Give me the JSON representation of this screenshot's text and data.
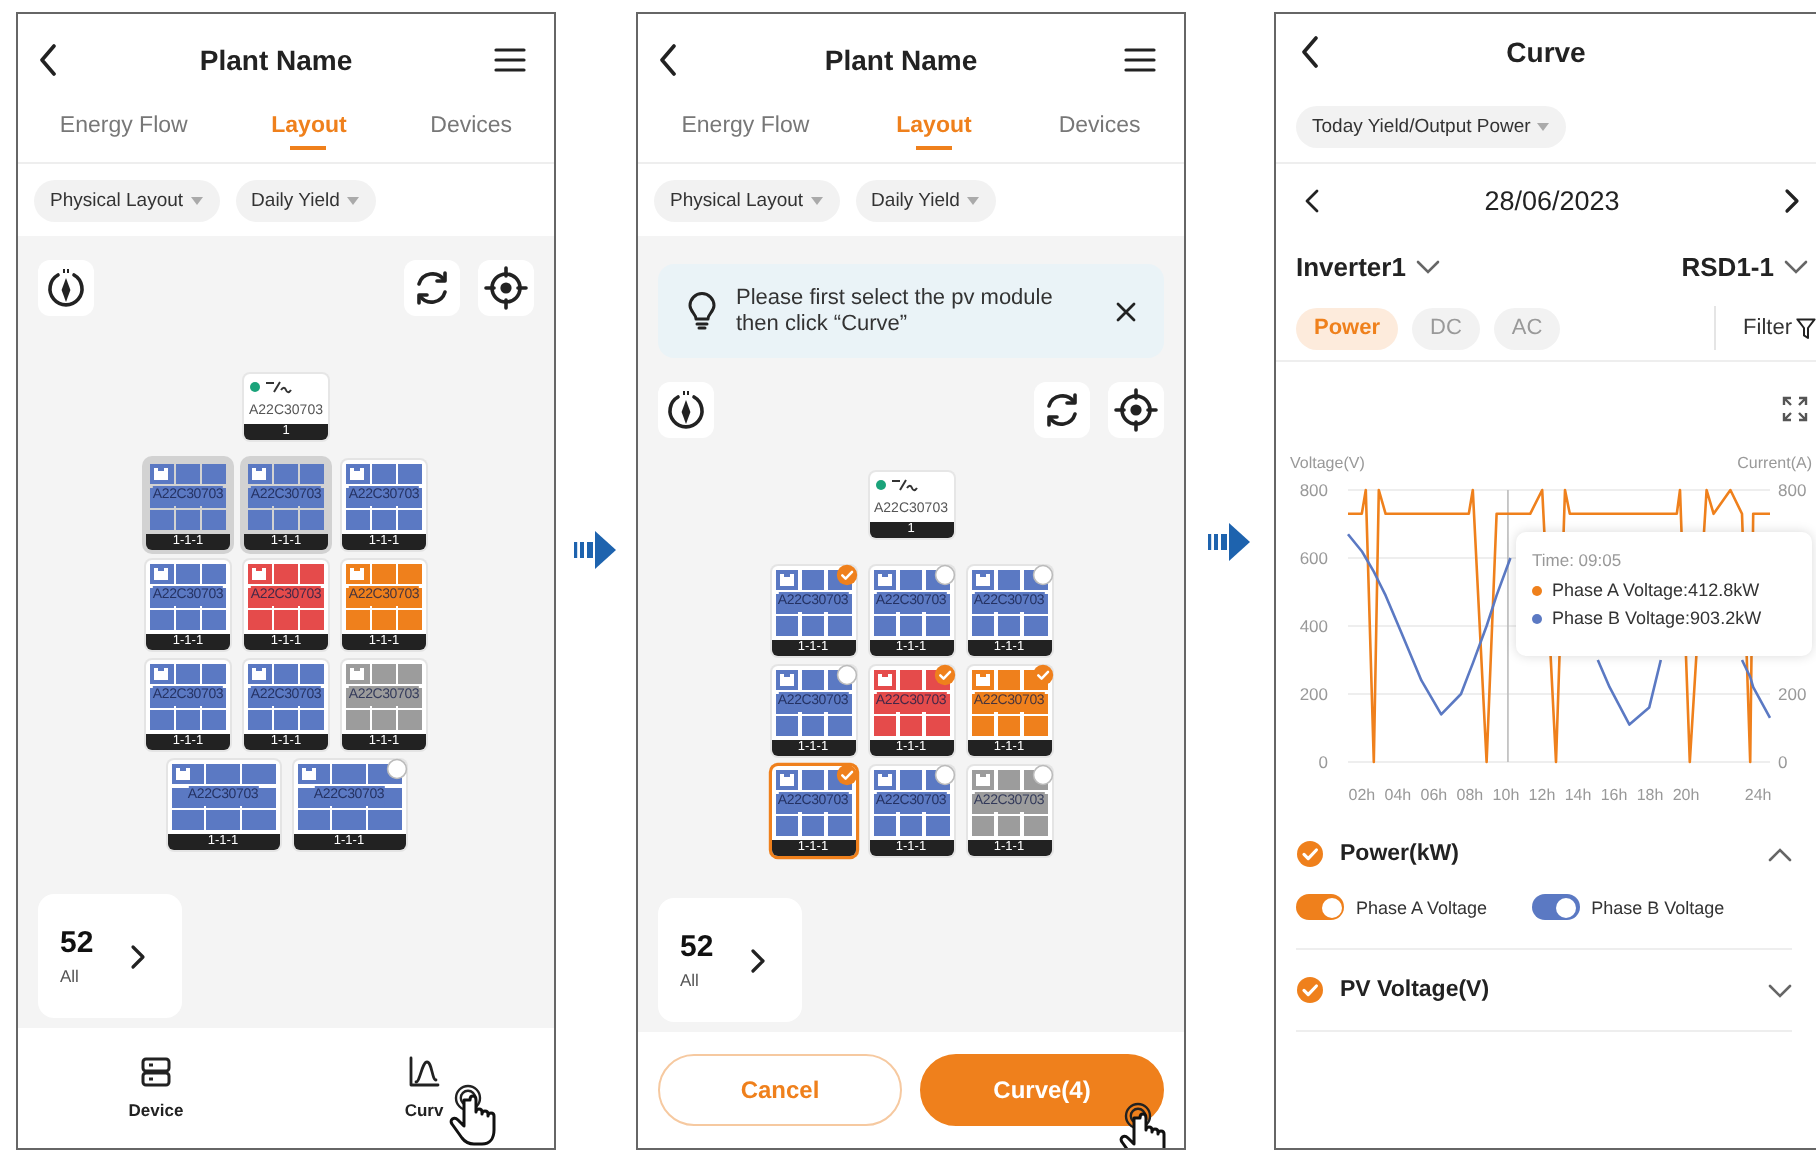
{
  "screens": [
    {
      "title": "Plant Name",
      "tabs": [
        {
          "label": "Energy Flow",
          "selected": false
        },
        {
          "label": "Layout",
          "selected": true
        },
        {
          "label": "Devices",
          "selected": false
        }
      ],
      "filters": [
        "Physical Layout",
        "Daily Yield"
      ],
      "inverter": {
        "online": true,
        "model": "A22C30703",
        "number": "1"
      },
      "panel_rows": [
        {
          "kind": "standard",
          "panels": [
            {
              "color": "#5b79c3",
              "model": "A22C30703",
              "position": "1-1-1",
              "highlighted": true
            },
            {
              "color": "#5b79c3",
              "model": "A22C30703",
              "position": "1-1-1",
              "highlighted": true
            },
            {
              "color": "#5b79c3",
              "model": "A22C30703",
              "position": "1-1-1",
              "highlighted": false
            }
          ]
        },
        {
          "kind": "standard",
          "panels": [
            {
              "color": "#5b79c3",
              "model": "A22C30703",
              "position": "1-1-1",
              "highlighted": false
            },
            {
              "color": "#e54b4b",
              "model": "A22C30703",
              "position": "1-1-1",
              "highlighted": false
            },
            {
              "color": "#ef801c",
              "model": "A22C30703",
              "position": "1-1-1",
              "highlighted": false
            }
          ]
        },
        {
          "kind": "standard",
          "panels": [
            {
              "color": "#5b79c3",
              "model": "A22C30703",
              "position": "1-1-1",
              "highlighted": false
            },
            {
              "color": "#5b79c3",
              "model": "A22C30703",
              "position": "1-1-1",
              "highlighted": false
            },
            {
              "color": "#9c9c9c",
              "model": "A22C30703",
              "position": "1-1-1",
              "highlighted": false
            }
          ]
        },
        {
          "kind": "wide",
          "panels": [
            {
              "color": "#5b79c3",
              "model": "A22C30703",
              "position": "1-1-1",
              "highlighted": false
            },
            {
              "color": "#5b79c3",
              "model": "A22C30703",
              "position": "1-1-1",
              "highlighted": false,
              "selected": false
            }
          ]
        }
      ],
      "summary": {
        "count": "52",
        "label": "All"
      },
      "nav": [
        {
          "kind": "device",
          "label": "Device",
          "pointer": false
        },
        {
          "kind": "curve",
          "label": "Curv",
          "pointer": true
        }
      ]
    },
    {
      "title": "Plant Name",
      "tabs": [
        {
          "label": "Energy Flow",
          "selected": false
        },
        {
          "label": "Layout",
          "selected": true
        },
        {
          "label": "Devices",
          "selected": false
        }
      ],
      "filters": [
        "Physical Layout",
        "Daily Yield"
      ],
      "tip": "Please first select the pv module then click “Curve”",
      "inverter": {
        "online": true,
        "model": "A22C30703",
        "number": "1"
      },
      "panel_rows": [
        {
          "kind": "standard",
          "panels": [
            {
              "color": "#5b79c3",
              "model": "A22C30703",
              "position": "1-1-1",
              "focused": false,
              "selected": true
            },
            {
              "color": "#5b79c3",
              "model": "A22C30703",
              "position": "1-1-1",
              "focused": false,
              "selected": false
            },
            {
              "color": "#5b79c3",
              "model": "A22C30703",
              "position": "1-1-1",
              "focused": false,
              "selected": false
            }
          ]
        },
        {
          "kind": "standard",
          "panels": [
            {
              "color": "#5b79c3",
              "model": "A22C30703",
              "position": "1-1-1",
              "focused": false,
              "selected": false
            },
            {
              "color": "#e54b4b",
              "model": "A22C30703",
              "position": "1-1-1",
              "focused": false,
              "selected": true
            },
            {
              "color": "#ef801c",
              "model": "A22C30703",
              "position": "1-1-1",
              "focused": false,
              "selected": true
            }
          ]
        },
        {
          "kind": "standard",
          "panels": [
            {
              "color": "#5b79c3",
              "model": "A22C30703",
              "position": "1-1-1",
              "focused": true,
              "selected": true
            },
            {
              "color": "#5b79c3",
              "model": "A22C30703",
              "position": "1-1-1",
              "focused": false,
              "selected": false
            },
            {
              "color": "#9c9c9c",
              "model": "A22C30703",
              "position": "1-1-1",
              "focused": false,
              "selected": false
            }
          ]
        }
      ],
      "summary": {
        "count": "52",
        "label": "All"
      },
      "actions": [
        {
          "kind": "secondary",
          "label": "Cancel",
          "pointer": false
        },
        {
          "kind": "primary",
          "label": "Curve(4)",
          "pointer": true
        }
      ]
    }
  ],
  "curve": {
    "title": "Curve",
    "metric": "Today Yield/Output Power",
    "date": "28/06/2023",
    "device": "Inverter1",
    "sub_device": "RSD1-1",
    "filter_tabs": [
      {
        "label": "Power",
        "selected": true
      },
      {
        "label": "DC",
        "selected": false
      },
      {
        "label": "AC",
        "selected": false
      }
    ],
    "filter_label": "Filter",
    "chart_data": {
      "type": "line",
      "ylabel": "Voltage(V)",
      "grid": true,
      "x": [
        1.23,
        2,
        2.22,
        2.66,
        2.94,
        3.32,
        4.2,
        5.3,
        6.4,
        7.5,
        7.94,
        8.16,
        8.93,
        9.48,
        10.25,
        11.35,
        12.01,
        12.78,
        13.28,
        13.55,
        15.1,
        15.75,
        16.85,
        17.95,
        18.6,
        19.49,
        19.66,
        20.21,
        21.14,
        21.53,
        22.46,
        23.1,
        23.56,
        23.73,
        24.66
      ],
      "series": [
        {
          "color": "#ef801c",
          "values": [
            730,
            730,
            800,
            0,
            800,
            730,
            730,
            730,
            730,
            730,
            730,
            800,
            0,
            730,
            730,
            730,
            800,
            0,
            800,
            730,
            730,
            730,
            730,
            730,
            730,
            730,
            800,
            0,
            800,
            730,
            800,
            730,
            0,
            730,
            730
          ]
        },
        {
          "color": "#5b79c3",
          "values": [
            670,
            620,
            600,
            560,
            530,
            490,
            380,
            240,
            140,
            200,
            260,
            290,
            400,
            490,
            600,
            null,
            null,
            null,
            null,
            null,
            300,
            220,
            110,
            160,
            300,
            null,
            null,
            null,
            null,
            null,
            null,
            300,
            250,
            220,
            130
          ]
        }
      ],
      "xlim": [
        1.23,
        24.66
      ],
      "ylim": [
        0,
        800
      ],
      "xticks": [
        {
          "value": 2,
          "label": "02h"
        },
        {
          "value": 4,
          "label": "04h"
        },
        {
          "value": 6,
          "label": "06h"
        },
        {
          "value": 8,
          "label": "08h"
        },
        {
          "value": 10,
          "label": "10h"
        },
        {
          "value": 12,
          "label": "12h"
        },
        {
          "value": 14,
          "label": "14h"
        },
        {
          "value": 16,
          "label": "16h"
        },
        {
          "value": 18,
          "label": "18h"
        },
        {
          "value": 20,
          "label": "20h"
        },
        {
          "value": 24,
          "label": "24h"
        }
      ],
      "yticks": [
        0,
        200,
        400,
        600,
        800
      ],
      "ref_lines": [
        {
          "axis": "x",
          "value": 10.11
        }
      ]
    },
    "right_axis": {
      "label": "Current(A)",
      "ticks": [
        "800",
        "200",
        "0"
      ]
    },
    "tooltip": {
      "time": "Time: 09:05",
      "rows": [
        {
          "label": "Phase A Voltage:412.8kW",
          "color": "#ef801c"
        },
        {
          "label": "Phase B Voltage:903.2kW",
          "color": "#5b79c3"
        }
      ]
    },
    "groups": [
      {
        "label": "Power(kW)",
        "checked": true,
        "expanded": true,
        "toggles": [
          {
            "label": "Phase A Voltage",
            "on": true,
            "color": "#ef801c"
          },
          {
            "label": "Phase B Voltage",
            "on": true,
            "color": "#5b79c3"
          }
        ]
      },
      {
        "label": "PV Voltage(V)",
        "checked": true,
        "expanded": false
      }
    ]
  }
}
